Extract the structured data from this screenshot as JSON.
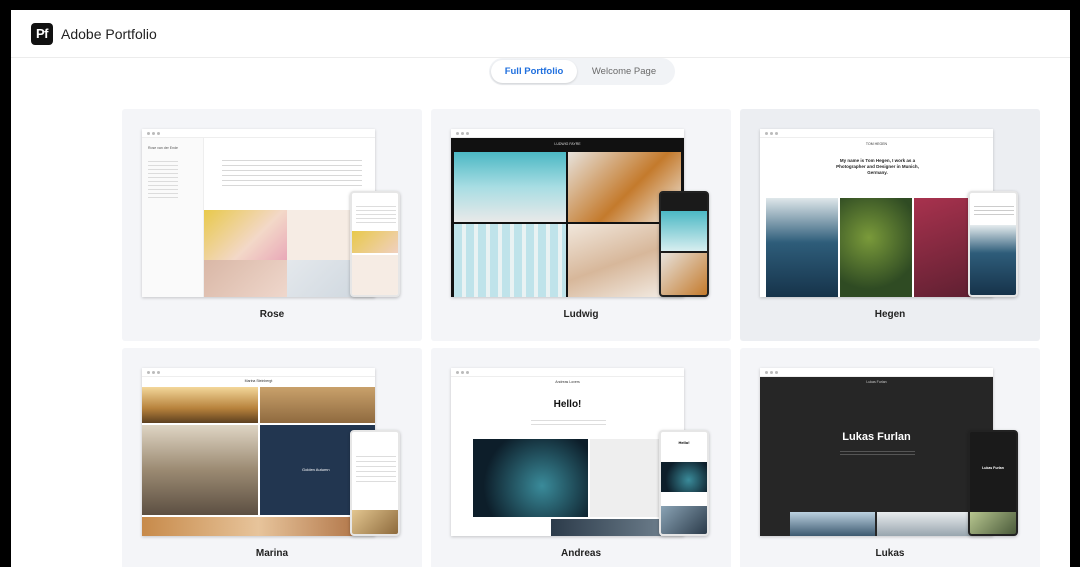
{
  "app": {
    "title": "Adobe Portfolio",
    "logo_text": "Pf"
  },
  "toggle": {
    "options": [
      "Full Portfolio",
      "Welcome Page"
    ],
    "selected": "Full Portfolio"
  },
  "themes": [
    {
      "name": "Rose",
      "site_title": "Rose van der Ende"
    },
    {
      "name": "Ludwig",
      "site_title": "LUDWIG FAYRE"
    },
    {
      "name": "Hegen",
      "site_title": "TOM HEGEN",
      "headline": "My name is Tom Hegen, I work as a Photographer and Designer in Munich, Germany."
    },
    {
      "name": "Marina",
      "site_title": "Marina Steinbergt",
      "overlay": "Golden Autumn"
    },
    {
      "name": "Andreas",
      "site_title": "Andreas Lovers",
      "headline": "Hello!"
    },
    {
      "name": "Lukas",
      "site_title": "Lukas Furlan",
      "headline": "Lukas Furlan"
    }
  ],
  "colors": {
    "accent": "#1f6fde",
    "card_bg": "#f4f5f8"
  }
}
